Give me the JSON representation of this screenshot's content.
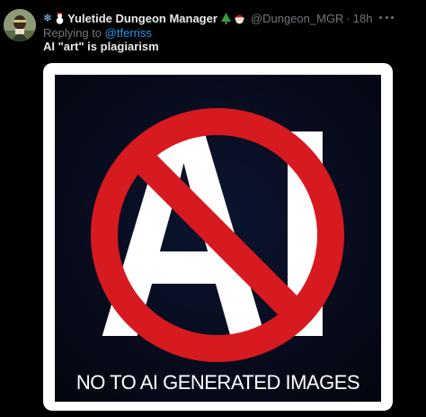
{
  "tweet": {
    "author": {
      "display_name": "Yuletide Dungeon Manager",
      "handle": "@Dungeon_MGR",
      "separator": "·",
      "time_ago": "18h",
      "name_prefix_icons": [
        "snowflake-icon",
        "snowman-icon"
      ],
      "name_suffix_icons": [
        "christmas-tree-icon",
        "santa-icon"
      ]
    },
    "reply": {
      "prefix": "Replying to",
      "user": "@tferriss"
    },
    "text": "AI \"art\" is plagiarism",
    "media": {
      "big_letters": "AI",
      "caption": "NO TO AI GENERATED IMAGES",
      "colors": {
        "prohibition_red": "#d71920",
        "background": "#070b1c",
        "letters": "#ffffff"
      }
    }
  },
  "colors": {
    "background": "#000000",
    "text_primary": "#e7e9ea",
    "text_secondary": "#71767b",
    "link": "#1d9bf0"
  }
}
